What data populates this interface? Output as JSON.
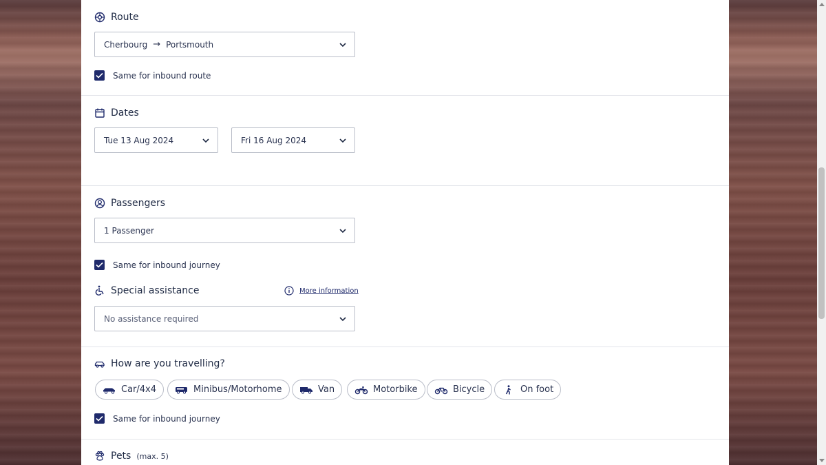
{
  "route": {
    "title": "Route",
    "from": "Cherbourg",
    "arrow": "→",
    "to": "Portsmouth",
    "same_label": "Same for inbound route"
  },
  "dates": {
    "title": "Dates",
    "outbound": "Tue 13 Aug 2024",
    "inbound": "Fri 16 Aug 2024"
  },
  "passengers": {
    "title": "Passengers",
    "value": "1 Passenger",
    "same_label": "Same for inbound journey"
  },
  "assistance": {
    "title": "Special assistance",
    "more_info": "More information",
    "value": "No assistance required"
  },
  "travel": {
    "title": "How are you travelling?",
    "options": [
      {
        "label": "Car/4x4",
        "icon": "car-icon"
      },
      {
        "label": "Minibus/Motorhome",
        "icon": "minibus-icon"
      },
      {
        "label": "Van",
        "icon": "van-icon"
      },
      {
        "label": "Motorbike",
        "icon": "motorbike-icon"
      },
      {
        "label": "Bicycle",
        "icon": "bicycle-icon"
      },
      {
        "label": "On foot",
        "icon": "walking-icon"
      }
    ],
    "same_label": "Same for inbound journey"
  },
  "pets": {
    "title": "Pets",
    "note": "(max. 5)"
  },
  "colors": {
    "accent": "#1f2a6b",
    "border": "#b9bdc8"
  }
}
